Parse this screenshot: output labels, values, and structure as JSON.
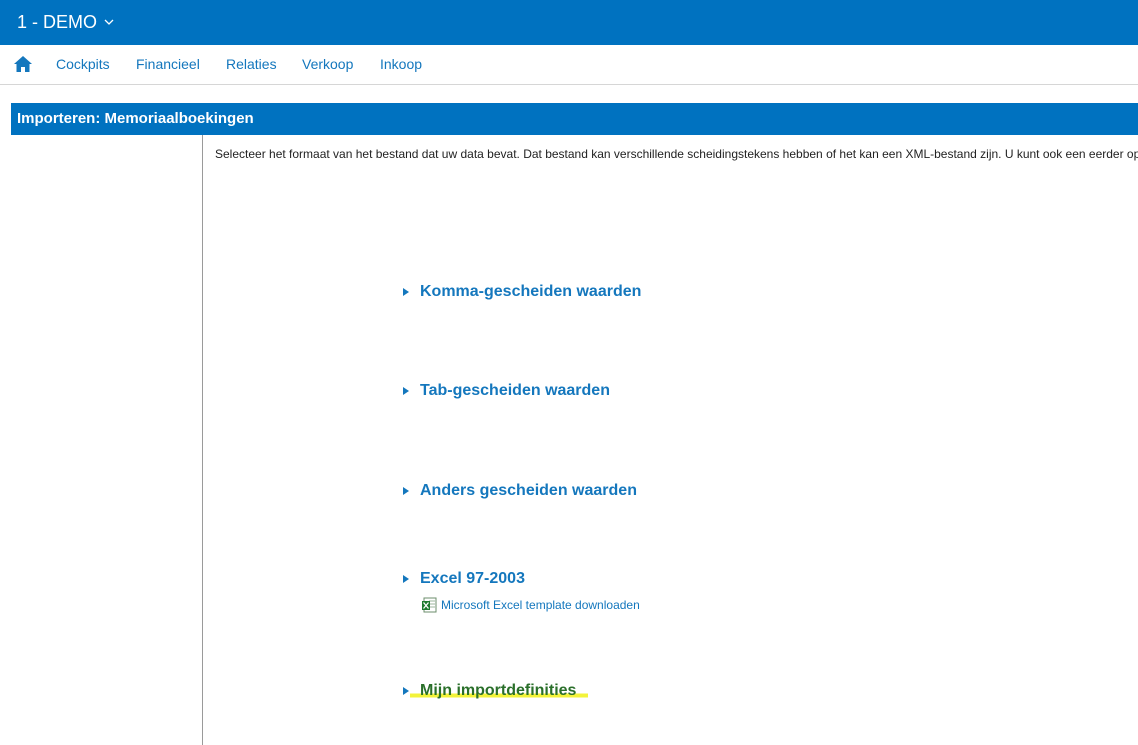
{
  "header": {
    "company": "1 - DEMO"
  },
  "nav": {
    "items": [
      "Cockpits",
      "Financieel",
      "Relaties",
      "Verkoop",
      "Inkoop"
    ]
  },
  "page": {
    "title": "Importeren: Memoriaalboekingen",
    "intro": "Selecteer het formaat van het bestand dat uw data bevat. Dat bestand kan verschillende scheidingstekens hebben of het kan een XML-bestand zijn. U kunt ook een eerder op"
  },
  "options": [
    {
      "label": "Komma-gescheiden waarden"
    },
    {
      "label": "Tab-gescheiden waarden"
    },
    {
      "label": "Anders gescheiden waarden"
    },
    {
      "label": "Excel 97-2003"
    },
    {
      "label": "Mijn importdefinities"
    }
  ],
  "excel_template": {
    "label": "Microsoft Excel template downloaden"
  },
  "colors": {
    "brand": "#0072c0",
    "link": "#1477bd",
    "highlight": "#f3f33a"
  }
}
